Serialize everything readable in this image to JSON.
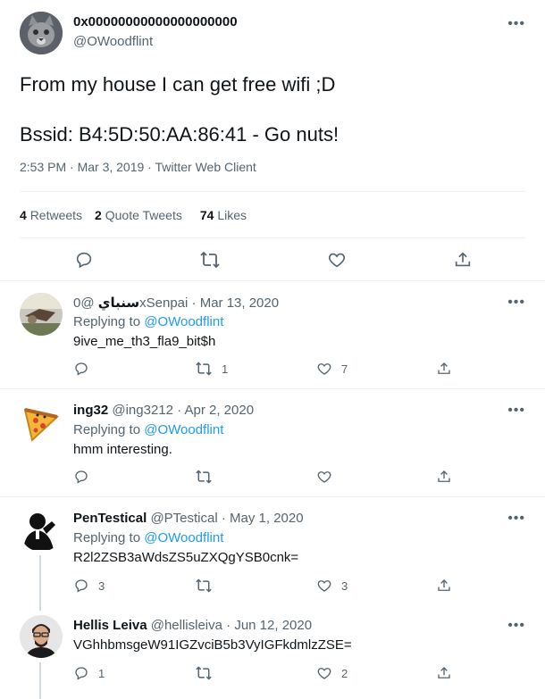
{
  "main_tweet": {
    "display_name": "0x00000000000000000000",
    "handle": "@OWoodflint",
    "text_line1": "From my house I can get free wifi ;D",
    "text_line2": "Bssid: B4:5D:50:AA:86:41 - Go nuts!",
    "meta": "2:53 PM · Mar 3, 2019 · Twitter Web Client",
    "retweets_count": "4",
    "retweets_label": "Retweets",
    "quotes_count": "2",
    "quotes_label": "Quote Tweets",
    "likes_count": "74",
    "likes_label": "Likes"
  },
  "replies": [
    {
      "display_name": "سنباي",
      "handle": "@0xSenpai",
      "date": "· Mar 13, 2020",
      "replying_prefix": "Replying to",
      "replying_to": "@OWoodflint",
      "text": "9ive_me_th3_fla9_bit$h",
      "reply_count": "",
      "retweet_count": "1",
      "like_count": "7"
    },
    {
      "display_name": "ing32",
      "handle": "@ing3212",
      "date": "· Apr 2, 2020",
      "replying_prefix": "Replying to",
      "replying_to": "@OWoodflint",
      "text": "hmm interesting.",
      "reply_count": "",
      "retweet_count": "",
      "like_count": ""
    },
    {
      "display_name": "PenTestical",
      "handle": "@PTestical",
      "date": "· May 1, 2020",
      "replying_prefix": "Replying to",
      "replying_to": "@OWoodflint",
      "text": "R2l2ZSB3aWdsZS5uZXQgYSB0cnk=",
      "reply_count": "3",
      "retweet_count": "",
      "like_count": "3"
    },
    {
      "display_name": "Hellis Leiva",
      "handle": "@hellisleiva",
      "date": "· Jun 12, 2020",
      "text": "VGhhbmsgeW91IGZvciB5b3VyIGFkdmlzZSE=",
      "reply_count": "1",
      "retweet_count": "",
      "like_count": "2"
    }
  ],
  "colors": {
    "link": "#1d9bf0",
    "muted": "#536471",
    "divider": "#eff3f4"
  },
  "icons": [
    "more-icon",
    "reply-icon",
    "retweet-icon",
    "like-icon",
    "share-icon"
  ]
}
